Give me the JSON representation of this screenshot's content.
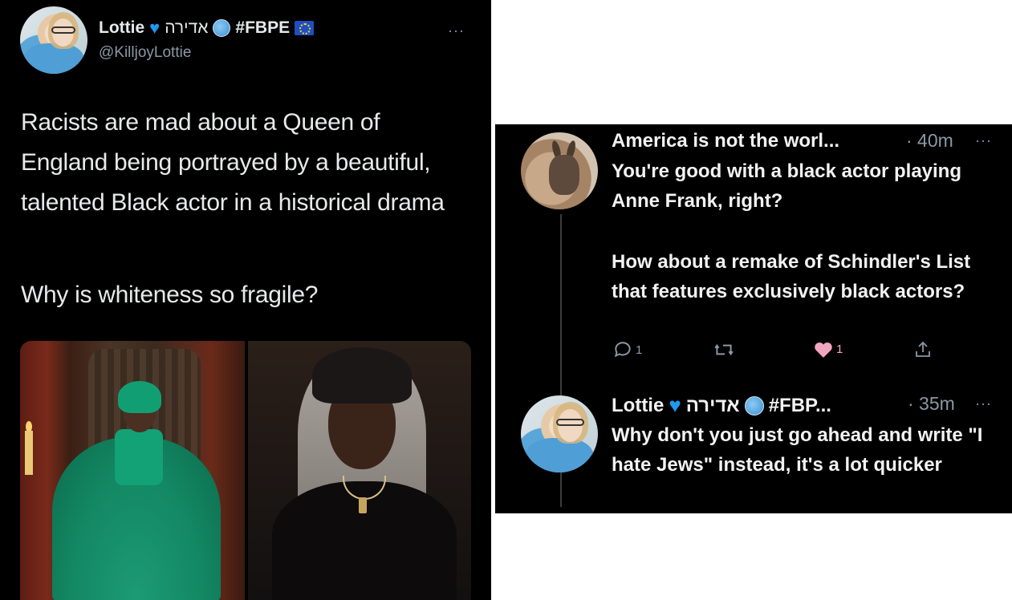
{
  "left_tweet": {
    "display_name": "Lottie",
    "name_hebrew": "אדירה",
    "name_tag": "#FBPE",
    "handle": "@KilljoyLottie",
    "more": "···",
    "text_1": "Racists are mad about a Queen of England being portrayed by a beautiful, talented Black actor in a historical drama",
    "text_2": "Why is whiteness so fragile?"
  },
  "reply_1": {
    "display_name": "America is not the worl...",
    "time": "· 40m",
    "more": "···",
    "text": "You're good with a black actor playing Anne Frank, right?",
    "text_2": "How about a remake of Schindler's List that features exclusively black actors?",
    "actions": {
      "reply_count": "1",
      "retweet_count": "",
      "like_count": "1"
    }
  },
  "reply_2": {
    "display_name": "Lottie",
    "name_hebrew": "אדירה",
    "name_tag": "#FBP...",
    "time": "· 35m",
    "more": "···",
    "text": "Why don't you just go ahead and write \"I hate Jews\" instead, it's a lot quicker"
  },
  "colors": {
    "background": "#000000",
    "text": "#e7e9ea",
    "muted": "#8b98a5",
    "heart_blue": "#1d9bf0",
    "like_pink": "#f91880"
  },
  "icons": [
    "blue-heart-icon",
    "globe-icon",
    "eu-flag-icon",
    "more-icon",
    "reply-icon",
    "retweet-icon",
    "like-icon",
    "share-icon"
  ]
}
